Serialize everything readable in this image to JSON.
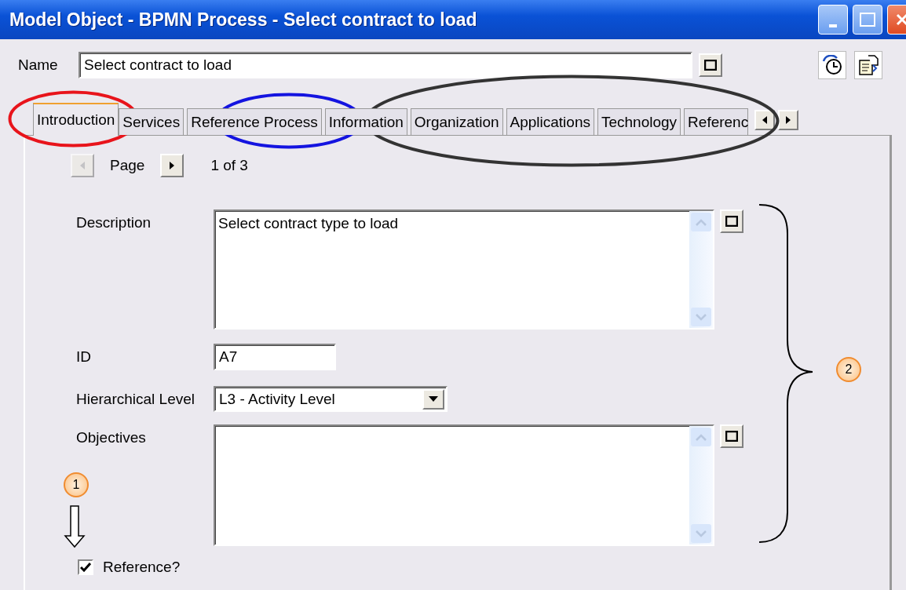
{
  "window": {
    "title": "Model Object - BPMN Process - Select contract to load"
  },
  "name_field": {
    "label": "Name",
    "value": "Select contract to load"
  },
  "tabs": [
    {
      "label": "Introduction",
      "selected": true
    },
    {
      "label": "Services",
      "selected": false
    },
    {
      "label": "Reference Process",
      "selected": false
    },
    {
      "label": "Information",
      "selected": false
    },
    {
      "label": "Organization",
      "selected": false
    },
    {
      "label": "Applications",
      "selected": false
    },
    {
      "label": "Technology",
      "selected": false
    },
    {
      "label": "Referenc",
      "selected": false
    }
  ],
  "pager": {
    "label": "Page",
    "position": "1 of 3",
    "prev_disabled": true,
    "next_disabled": false
  },
  "form": {
    "description": {
      "label": "Description",
      "value": "Select contract type to load"
    },
    "id": {
      "label": "ID",
      "value": "A7"
    },
    "hierarchical_level": {
      "label": "Hierarchical Level",
      "value": "L3 - Activity Level"
    },
    "objectives": {
      "label": "Objectives"
    },
    "reference": {
      "label": "Reference?",
      "checked": true
    }
  },
  "annotations": {
    "ellipses": [
      {
        "color": "#e8141b"
      },
      {
        "color": "#1414e0"
      },
      {
        "color": "#333333"
      }
    ],
    "markers": [
      {
        "label": "1"
      },
      {
        "label": "2"
      }
    ]
  }
}
